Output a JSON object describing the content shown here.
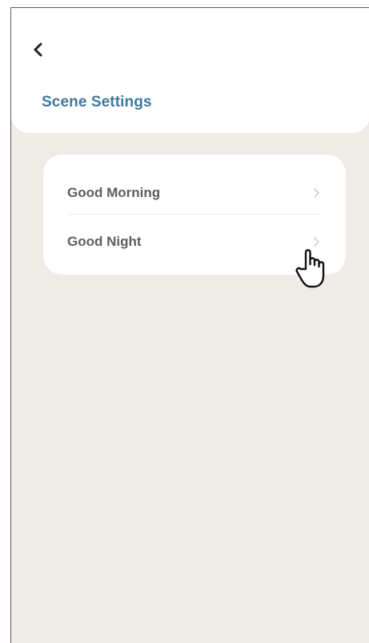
{
  "header": {
    "back_icon": "chevron-left-icon",
    "title": "Scene Settings"
  },
  "scenes": {
    "items": [
      {
        "label": "Good Morning",
        "icon": "chevron-right-icon"
      },
      {
        "label": "Good Night",
        "icon": "chevron-right-icon"
      }
    ]
  },
  "overlay": {
    "cursor_icon": "hand-pointer-icon"
  },
  "colors": {
    "background": "#efebe7",
    "card": "#ffffff",
    "title": "#3f7a9b",
    "item_text": "#5e5e5e",
    "chevron": "#c8c8c8"
  }
}
